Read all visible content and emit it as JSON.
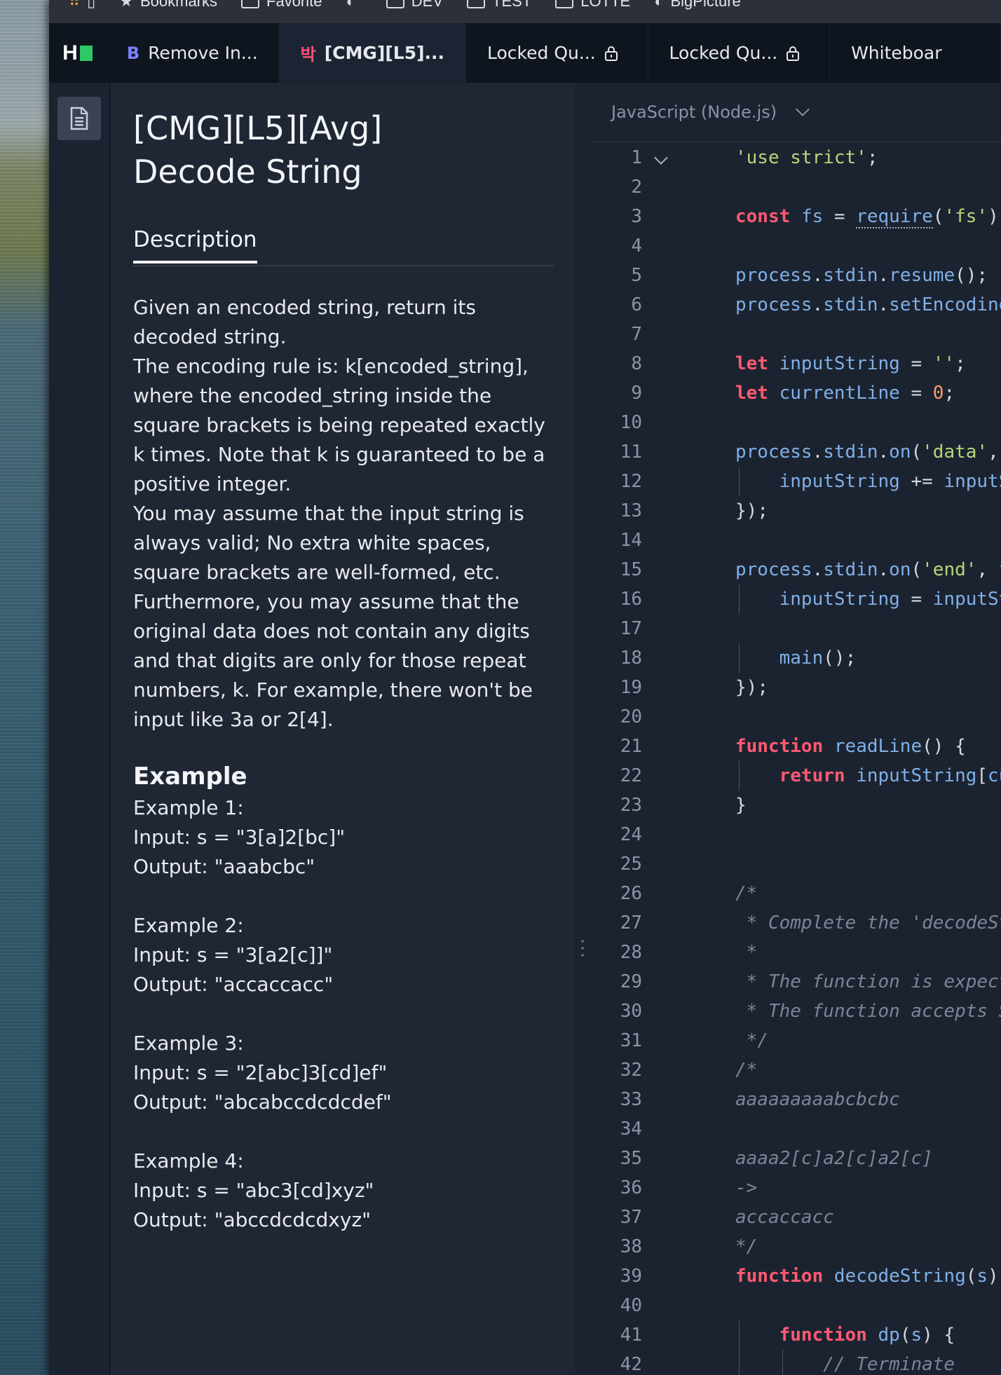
{
  "bookmarks_bar": {
    "items": [
      {
        "label": "Bookmarks",
        "icon": "star-icon"
      },
      {
        "label": "Favorite",
        "icon": "folder-icon"
      },
      {
        "label": "",
        "icon": "globe-icon"
      },
      {
        "label": "DEV",
        "icon": "folder-icon"
      },
      {
        "label": "TEST",
        "icon": "folder-icon"
      },
      {
        "label": "LOTTE",
        "icon": "folder-icon"
      },
      {
        "label": "BigPicture",
        "icon": "globe-icon"
      }
    ]
  },
  "tabs": [
    {
      "label": "Remove In...",
      "icon_text": "B",
      "active": false,
      "locked": false
    },
    {
      "label": "[CMG][L5]...",
      "icon_text": "박",
      "active": true,
      "locked": false
    },
    {
      "label": "Locked Qu...",
      "active": false,
      "locked": true
    },
    {
      "label": "Locked Qu...",
      "active": false,
      "locked": true
    },
    {
      "label": "Whiteboar",
      "active": false,
      "locked": false
    }
  ],
  "problem": {
    "title": "[CMG][L5][Avg] Decode String",
    "description_tab": "Description",
    "paragraphs": [
      "Given an encoded string, return its decoded string.",
      "The encoding rule is: k[encoded_string], where the encoded_string inside the square brackets is being repeated exactly k times. Note that k is guaranteed to be a positive integer.",
      "You may assume that the input string is always valid; No extra white spaces, square brackets are well-formed, etc.",
      "Furthermore, you may assume that the original data does not contain any digits and that digits are only for those repeat numbers, k. For example, there won't be input like 3a or 2[4]."
    ],
    "example_heading": "Example",
    "examples": [
      {
        "title": "Example 1:",
        "input": "Input: s = \"3[a]2[bc]\"",
        "output": "Output: \"aaabcbc\""
      },
      {
        "title": "Example 2:",
        "input": "Input: s = \"3[a2[c]]\"",
        "output": "Output: \"accaccacc\""
      },
      {
        "title": "Example 3:",
        "input": "Input: s = \"2[abc]3[cd]ef\"",
        "output": "Output: \"abcabccdcdcdef\""
      },
      {
        "title": "Example 4:",
        "input": "Input: s = \"abc3[cd]xyz\"",
        "output": "Output: \"abccdcdcdxyz\""
      }
    ]
  },
  "editor": {
    "language": "JavaScript (Node.js)",
    "code_lines": [
      "'use strict';",
      "",
      "const fs = require('fs');",
      "",
      "process.stdin.resume();",
      "process.stdin.setEncoding('",
      "",
      "let inputString = '';",
      "let currentLine = 0;",
      "",
      "process.stdin.on('data', fu",
      "    inputString += inputStd",
      "});",
      "",
      "process.stdin.on('end', fun",
      "    inputString = inputStri",
      "",
      "    main();",
      "});",
      "",
      "function readLine() {",
      "    return inputString[curr",
      "}",
      "",
      "",
      "/*",
      " * Complete the 'decodeStri",
      " *",
      " * The function is expected",
      " * The function accepts STR",
      " */",
      "/*",
      "aaaaaaaaabcbcbc",
      "",
      "aaaa2[c]a2[c]a2[c]",
      "->",
      "accaccacc",
      "*/",
      "function decodeString(s) {",
      "",
      "    function dp(s) {",
      "        // Terminate"
    ]
  },
  "colors": {
    "keyword": "#ff5a73",
    "string": "#b5d779",
    "identifier": "#7fb0e8",
    "number": "#ff9a6a",
    "comment": "#7c8595",
    "brand_green": "#2ec866"
  }
}
